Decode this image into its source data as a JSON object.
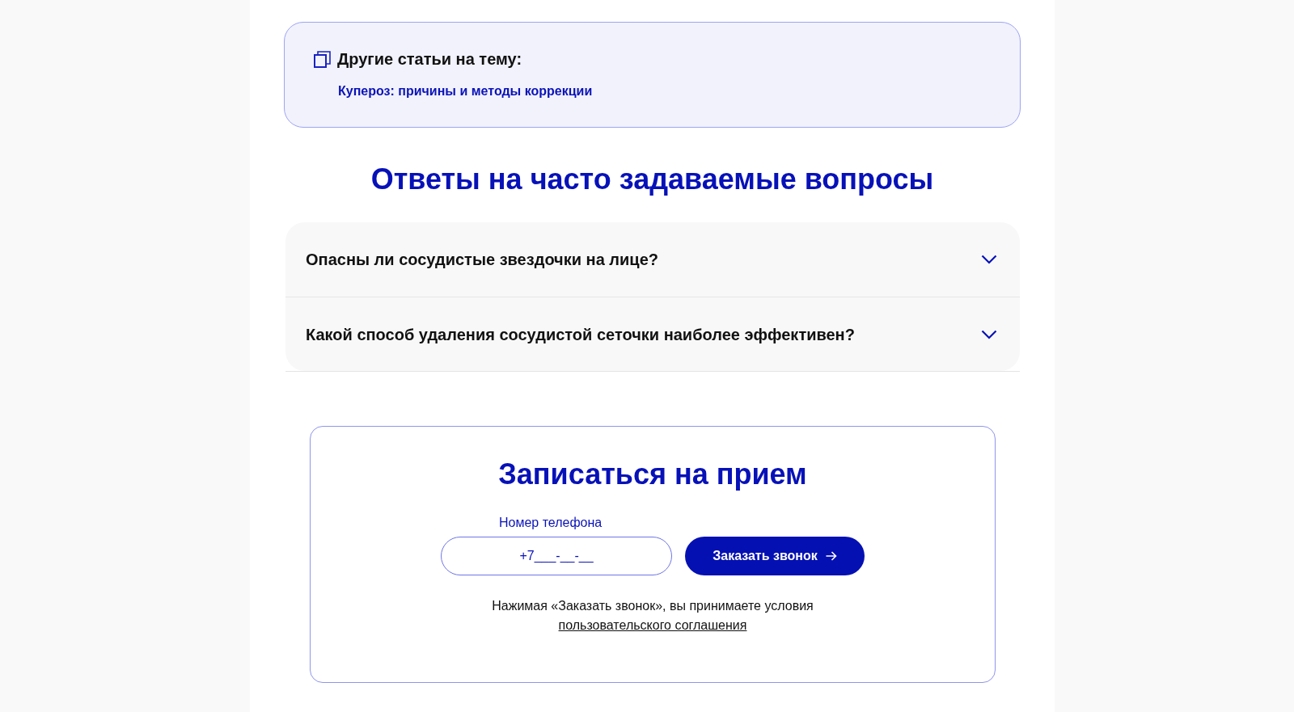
{
  "related": {
    "title": "Другие статьи на тему:",
    "links": [
      "Купероз: причины и методы коррекции"
    ]
  },
  "faq": {
    "title": "Ответы на часто задаваемые вопросы",
    "items": [
      {
        "question": "Опасны ли сосудистые звездочки на лице?",
        "expanded": false
      },
      {
        "question": "Какой способ удаления сосудистой сеточки наиболее эффективен?",
        "expanded": false
      }
    ]
  },
  "booking": {
    "title": "Записаться на прием",
    "phone": {
      "label": "Номер телефона",
      "placeholder": "+7___-__-__"
    },
    "submit": "Заказать звонок",
    "consent": "Нажимая «Заказать звонок», вы принимаете условия",
    "consent_link": "пользовательского соглашения"
  }
}
